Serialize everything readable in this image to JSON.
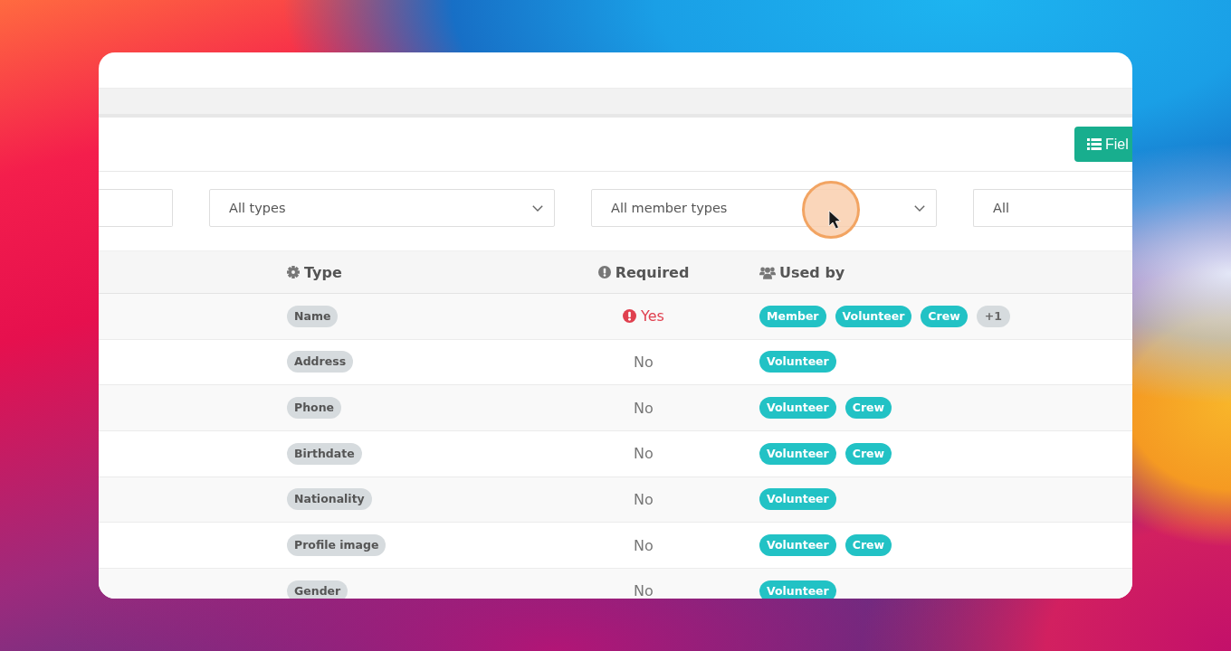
{
  "toolbar": {
    "button": {
      "label": "Fiel"
    }
  },
  "filters": [
    {
      "kind": "text"
    },
    {
      "kind": "select",
      "value": "All types",
      "chevron": true
    },
    {
      "kind": "select",
      "value": "All member types",
      "chevron": true
    },
    {
      "kind": "select",
      "value": "All",
      "chevron": false
    }
  ],
  "table": {
    "columns": [
      "Type",
      "Required",
      "Used by"
    ],
    "rows": [
      {
        "type": "Name",
        "required": true,
        "required_label": "Yes",
        "used_by": [
          "Member",
          "Volunteer",
          "Crew"
        ],
        "more": "+1"
      },
      {
        "type": "Address",
        "required": false,
        "required_label": "No",
        "used_by": [
          "Volunteer"
        ]
      },
      {
        "type": "Phone",
        "required": false,
        "required_label": "No",
        "used_by": [
          "Volunteer",
          "Crew"
        ]
      },
      {
        "type": "Birthdate",
        "required": false,
        "required_label": "No",
        "used_by": [
          "Volunteer",
          "Crew"
        ]
      },
      {
        "type": "Nationality",
        "required": false,
        "required_label": "No",
        "used_by": [
          "Volunteer"
        ]
      },
      {
        "type": "Profile image",
        "required": false,
        "required_label": "No",
        "used_by": [
          "Volunteer",
          "Crew"
        ]
      },
      {
        "type": "Gender",
        "required": false,
        "required_label": "No",
        "used_by": [
          "Volunteer"
        ]
      }
    ]
  }
}
